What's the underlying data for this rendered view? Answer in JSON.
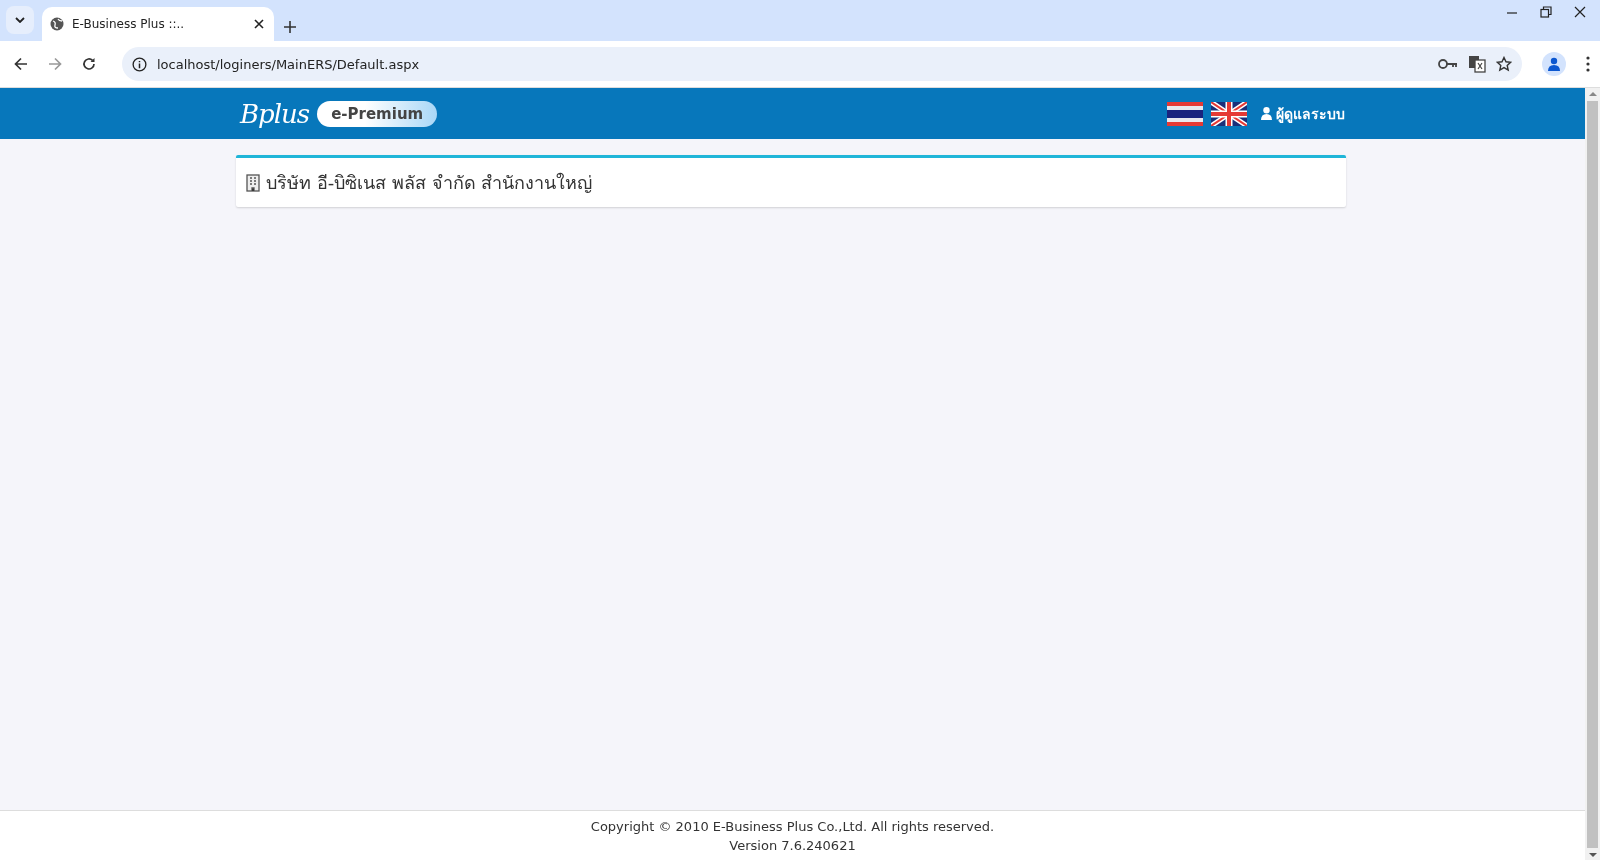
{
  "browser": {
    "tab": {
      "title": "E-Business Plus ::..",
      "selected": true
    },
    "address": "localhost/loginers/MainERS/Default.aspx"
  },
  "header": {
    "logo": "Bplus",
    "product": "e-Premium",
    "user": "ผู้ดูแลระบบ"
  },
  "company_card": {
    "title": "บริษัท อี-บิซิเนส พลัส จำกัด สำนักงานใหญ่"
  },
  "footer": {
    "copyright": "Copyright © 2010 E-Business Plus Co.,Ltd. All rights reserved.",
    "version": "Version 7.6.240621"
  }
}
